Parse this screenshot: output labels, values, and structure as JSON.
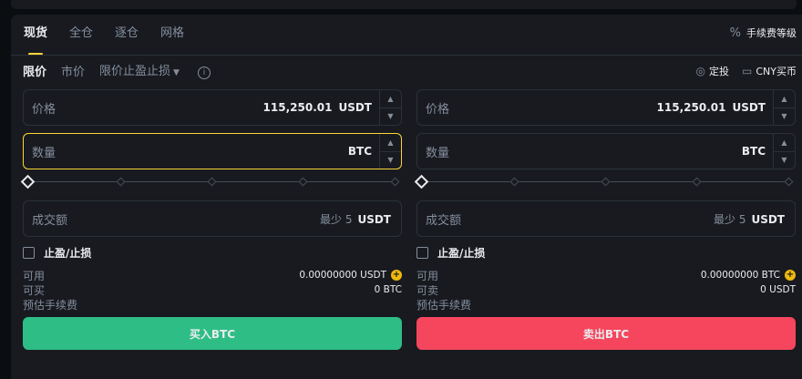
{
  "tabs": [
    "现货",
    "全仓",
    "逐仓",
    "网格"
  ],
  "fee_level": "手续费等级",
  "order_types": [
    "限价",
    "市价",
    "限价止盈止损"
  ],
  "right_options": {
    "auto_invest": "定投",
    "cny_buy": "CNY买币"
  },
  "buy": {
    "price_label": "价格",
    "price_value": "115,250.01",
    "price_unit": "USDT",
    "qty_label": "数量",
    "qty_unit": "BTC",
    "total_label": "成交额",
    "total_min": "最少 5",
    "total_unit": "USDT",
    "tpsl_label": "止盈/止损",
    "available_label": "可用",
    "available_value": "0.00000000 USDT",
    "can_buy_label": "可买",
    "can_buy_value": "0 BTC",
    "fee_label": "预估手续费",
    "button": "买入BTC"
  },
  "sell": {
    "price_label": "价格",
    "price_value": "115,250.01",
    "price_unit": "USDT",
    "qty_label": "数量",
    "qty_unit": "BTC",
    "total_label": "成交额",
    "total_min": "最少 5",
    "total_unit": "USDT",
    "tpsl_label": "止盈/止损",
    "available_label": "可用",
    "available_value": "0.00000000 BTC",
    "can_sell_label": "可卖",
    "can_sell_value": "0 USDT",
    "fee_label": "预估手续费",
    "button": "卖出BTC"
  },
  "colors": {
    "accent": "#fcd535",
    "buy": "#2ebd85",
    "sell": "#f6465d"
  }
}
